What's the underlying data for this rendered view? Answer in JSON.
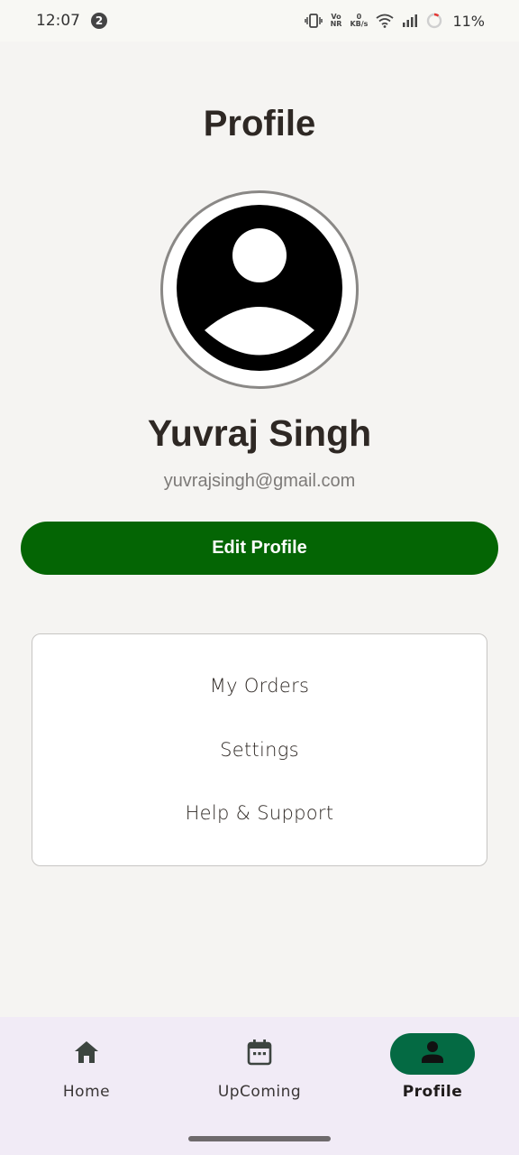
{
  "status_bar": {
    "time": "12:07",
    "notification_count": "2",
    "volte_top": "Vo",
    "volte_bottom": "NR",
    "net_speed_value": "0",
    "net_speed_unit": "KB/s",
    "battery": "11%",
    "battery_low_color": "#e53935"
  },
  "page": {
    "title": "Profile"
  },
  "profile": {
    "name": "Yuvraj Singh",
    "email": "yuvrajsingh@gmail.com",
    "avatar_icon": "user-avatar-icon"
  },
  "actions": {
    "edit_profile_label": "Edit Profile",
    "accent_color": "#046504"
  },
  "menu": {
    "items": [
      {
        "label": "My Orders"
      },
      {
        "label": "Settings"
      },
      {
        "label": "Help & Support"
      }
    ]
  },
  "bottom_nav": {
    "items": [
      {
        "label": "Home",
        "icon": "home-icon",
        "active": false
      },
      {
        "label": "UpComing",
        "icon": "calendar-icon",
        "active": false
      },
      {
        "label": "Profile",
        "icon": "person-icon",
        "active": true
      }
    ],
    "active_color": "#046a43"
  }
}
